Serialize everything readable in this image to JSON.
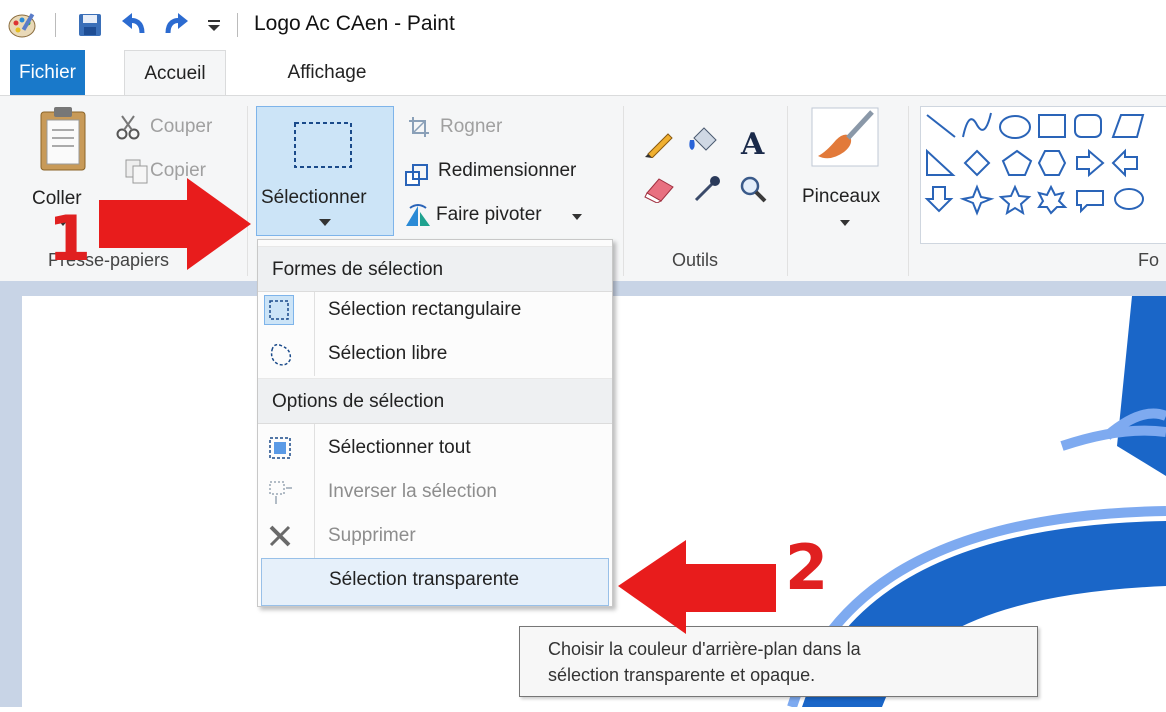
{
  "window": {
    "title": "Logo Ac CAen - Paint"
  },
  "tabs": [
    {
      "label": "Fichier"
    },
    {
      "label": "Accueil"
    },
    {
      "label": "Affichage"
    }
  ],
  "ribbon": {
    "clipboard": {
      "paste_label": "Coller",
      "cut_label": "Couper",
      "copy_label": "Copier",
      "group_label": "Presse-papiers"
    },
    "image": {
      "select_label": "Sélectionner",
      "crop_label": "Rogner",
      "resize_label": "Redimensionner",
      "rotate_label": "Faire pivoter"
    },
    "tools": {
      "group_label": "Outils"
    },
    "brushes": {
      "label": "Pinceaux"
    },
    "shapes": {
      "group_label": "Fo"
    }
  },
  "select_menu": {
    "section1": "Formes de sélection",
    "rect_select": "Sélection rectangulaire",
    "free_select": "Sélection libre",
    "section2": "Options de sélection",
    "select_all": "Sélectionner tout",
    "invert": "Inverser la sélection",
    "delete": "Supprimer",
    "transparent": "Sélection transparente"
  },
  "tooltip": {
    "line1": "Choisir la couleur d'arrière-plan dans la",
    "line2": "sélection transparente et opaque."
  },
  "annotations": {
    "arrow1_num": "1",
    "arrow2_num": "2",
    "arrow_color": "#e81c1c"
  },
  "colors": {
    "accent": "#1979ca",
    "highlight": "#e6f0fa",
    "logo_blue": "#1a66c8"
  }
}
